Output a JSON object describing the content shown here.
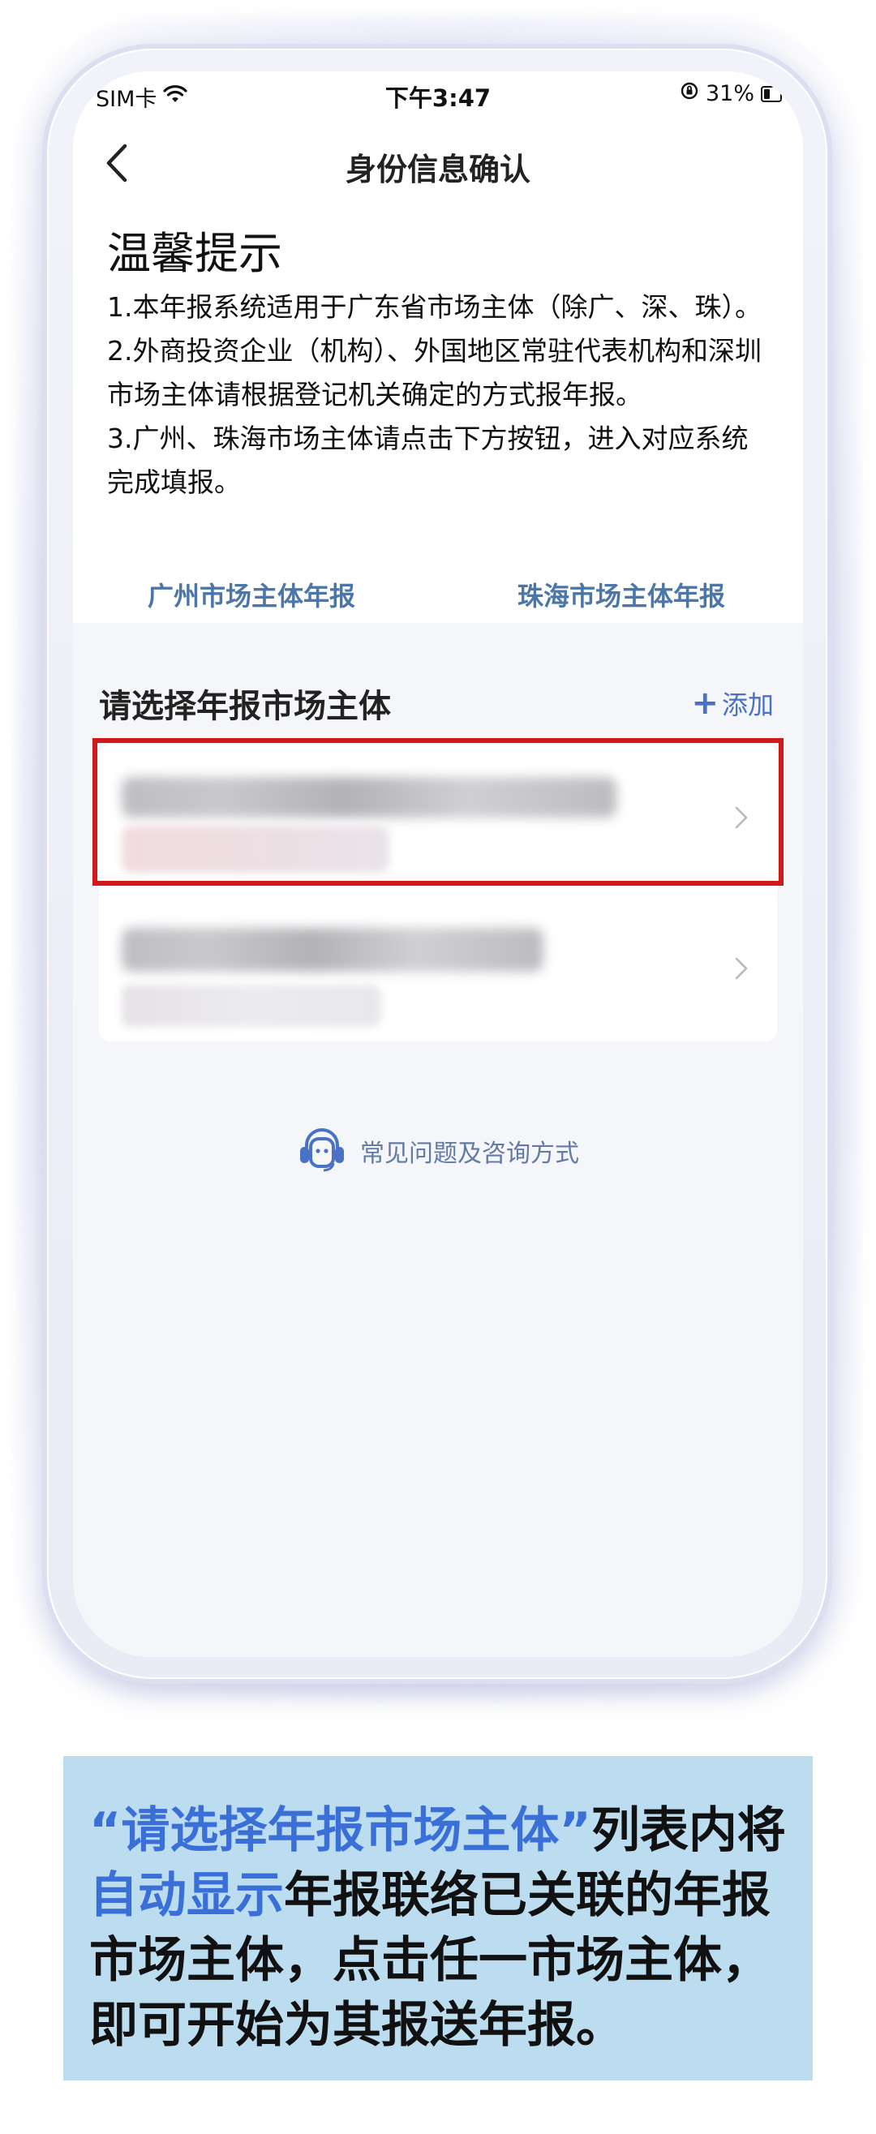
{
  "status_bar": {
    "carrier": "SIM卡",
    "time": "下午3:47",
    "battery": "31%"
  },
  "nav": {
    "title": "身份信息确认"
  },
  "tips": {
    "title": "温馨提示",
    "lines": [
      "1.本年报系统适用于广东省市场主体（除广、深、珠）。",
      "2.外商投资企业（机构）、外国地区常驻代表机构和深圳市场主体请根据登记机关确定的方式报年报。",
      "3.广州、珠海市场主体请点击下方按钮，进入对应系统完成填报。"
    ],
    "links": {
      "guangzhou": "广州市场主体年报",
      "zhuhai": "珠海市场主体年报"
    }
  },
  "market": {
    "section_title": "请选择年报市场主体",
    "add_label": "添加"
  },
  "faq": {
    "label": "常见问题及咨询方式"
  },
  "caption": {
    "quote": "“请选择年报市场主体”",
    "text1": "列表内将",
    "highlight": "自动显示",
    "text2": "年报联络已关联的年报市场主体，点击任一市场主体，即可开始为其报送年报。"
  },
  "colors": {
    "accent": "#4a72c4",
    "highlight_border": "#d01a1a",
    "caption_bg": "#bcdcf0",
    "caption_highlight": "#3a6fd8"
  }
}
